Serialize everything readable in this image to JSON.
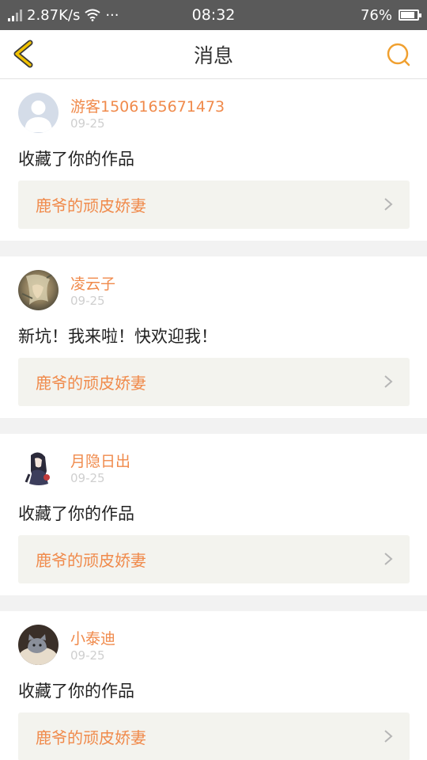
{
  "status_bar": {
    "net_speed": "2.87K/s",
    "more": "···",
    "time": "08:32",
    "battery_percent": "76%",
    "battery_level": 0.76
  },
  "nav": {
    "back_icon": "chevron-left-icon",
    "title": "消息",
    "search_icon": "search-icon",
    "accent": "#f0a030"
  },
  "messages": [
    {
      "username": "游客1506165671473",
      "date": "09-25",
      "text": "收藏了你的作品",
      "work_title": "鹿爷的顽皮娇妻",
      "avatar": "default-user-avatar"
    },
    {
      "username": "凌云子",
      "date": "09-25",
      "text": "新坑！我来啦！快欢迎我！",
      "work_title": "鹿爷的顽皮娇妻",
      "avatar": "anime-warrior-avatar"
    },
    {
      "username": "月隐日出",
      "date": "09-25",
      "text": "收藏了你的作品",
      "work_title": "鹿爷的顽皮娇妻",
      "avatar": "anime-girl-avatar"
    },
    {
      "username": "小泰迪",
      "date": "09-25",
      "text": "收藏了你的作品",
      "work_title": "鹿爷的顽皮娇妻",
      "avatar": "cat-avatar"
    }
  ],
  "colors": {
    "username": "#f08a4b",
    "work_title": "#f08a4b",
    "date": "#cfcfcf",
    "card_link_bg": "#f3f3ee"
  }
}
